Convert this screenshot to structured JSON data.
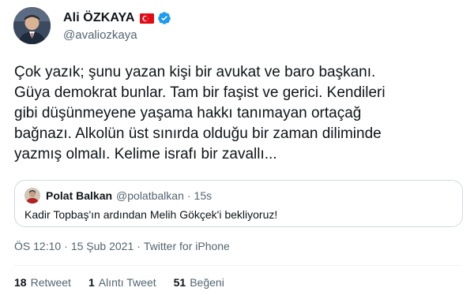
{
  "author": {
    "display_name": "Ali ÖZKAYA",
    "handle": "@avaliozkaya",
    "flag_icon": "turkey-flag-icon",
    "verified_icon": "verified-badge-icon",
    "verified_color": "#1d9bf0"
  },
  "tweet": {
    "text": "Çok yazık; şunu yazan kişi bir avukat ve baro başkanı.\nGüya demokrat bunlar. Tam bir faşist ve gerici. Kendileri\ngibi düşünmeyene yaşama hakkı tanımayan ortaçağ\nbağnazı. Alkolün üst sınırda olduğu bir zaman diliminde\nyazmış olmalı. Kelime israfı bir zavallı..."
  },
  "quoted_tweet": {
    "display_name": "Polat Balkan",
    "handle": "@polatbalkan",
    "separator": "·",
    "time": "15s",
    "text": "Kadir Topbaş'ın ardından Melih Gökçek'i bekliyoruz!"
  },
  "meta": {
    "time": "ÖS 12:10",
    "separator1": "·",
    "date": "15 Şub 2021",
    "separator2": "·",
    "source": "Twitter for iPhone"
  },
  "stats": {
    "retweets_count": "18",
    "retweets_label": "Retweet",
    "quotes_count": "1",
    "quotes_label": "Alıntı Tweet",
    "likes_count": "51",
    "likes_label": "Beğeni"
  }
}
